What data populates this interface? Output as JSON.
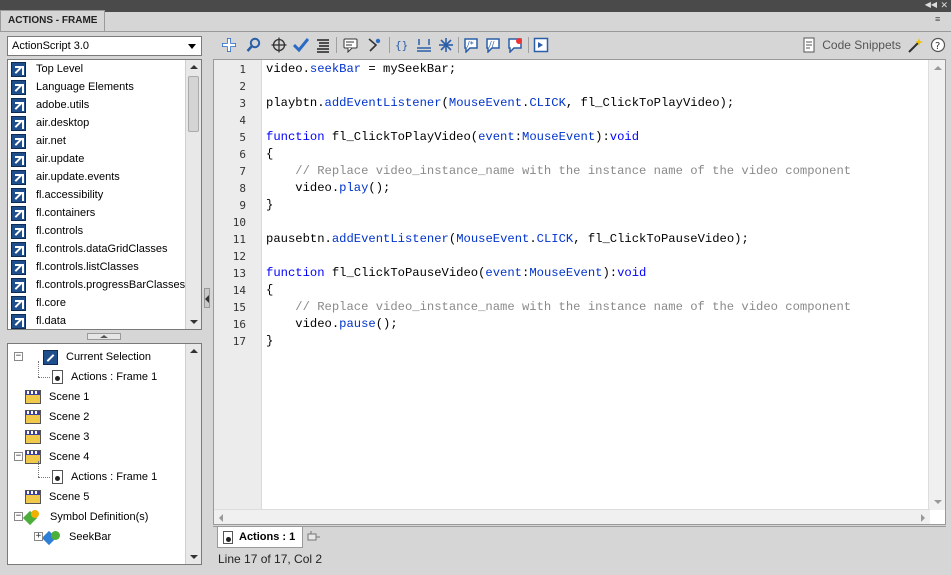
{
  "window": {
    "title": "ACTIONS - FRAME"
  },
  "left_panel": {
    "version_select": "ActionScript 3.0",
    "packages": [
      {
        "label": "Top Level"
      },
      {
        "label": "Language Elements"
      },
      {
        "label": "adobe.utils"
      },
      {
        "label": "air.desktop"
      },
      {
        "label": "air.net"
      },
      {
        "label": "air.update"
      },
      {
        "label": "air.update.events"
      },
      {
        "label": "fl.accessibility"
      },
      {
        "label": "fl.containers"
      },
      {
        "label": "fl.controls"
      },
      {
        "label": "fl.controls.dataGridClasses"
      },
      {
        "label": "fl.controls.listClasses"
      },
      {
        "label": "fl.controls.progressBarClasses"
      },
      {
        "label": "fl.core"
      },
      {
        "label": "fl.data"
      }
    ],
    "tree": [
      {
        "label": "Current Selection",
        "icon": "selection-icon"
      },
      {
        "label": "Actions : Frame 1",
        "icon": "frame-icon"
      },
      {
        "label": "Scene 1",
        "icon": "scene-icon"
      },
      {
        "label": "Scene 2",
        "icon": "scene-icon"
      },
      {
        "label": "Scene 3",
        "icon": "scene-icon"
      },
      {
        "label": "Scene 4",
        "icon": "scene-icon"
      },
      {
        "label": "Actions : Frame 1",
        "icon": "frame-icon"
      },
      {
        "label": "Scene 5",
        "icon": "scene-icon"
      },
      {
        "label": "Symbol Definition(s)",
        "icon": "symbol-icon"
      },
      {
        "label": "SeekBar",
        "icon": "seekbar-icon"
      }
    ]
  },
  "toolbar": {
    "code_snippets_label": "Code Snippets",
    "icons": [
      "add-statement-icon",
      "find-icon",
      "insert-target-path-icon",
      "check-syntax-icon",
      "auto-format-icon",
      "show-code-hint-icon",
      "debug-options-icon",
      "collapse-between-braces-icon",
      "collapse-selection-icon",
      "expand-all-icon",
      "apply-block-comment-icon",
      "apply-line-comment-icon",
      "remove-comment-icon",
      "show-hide-toolbox-icon",
      "code-snippets-icon",
      "wizard-icon",
      "help-icon"
    ]
  },
  "editor": {
    "lines": [
      {
        "n": "1",
        "segments": [
          {
            "t": "video."
          },
          {
            "t": "seekBar",
            "c": "fn"
          },
          {
            "t": " = mySeekBar;"
          }
        ]
      },
      {
        "n": "2",
        "segments": []
      },
      {
        "n": "3",
        "segments": [
          {
            "t": "playbtn."
          },
          {
            "t": "addEventListener",
            "c": "fn"
          },
          {
            "t": "("
          },
          {
            "t": "MouseEvent",
            "c": "ty"
          },
          {
            "t": "."
          },
          {
            "t": "CLICK",
            "c": "fn"
          },
          {
            "t": ", fl_ClickToPlayVideo);"
          }
        ]
      },
      {
        "n": "4",
        "segments": []
      },
      {
        "n": "5",
        "segments": [
          {
            "t": "function",
            "c": "kw"
          },
          {
            "t": " fl_ClickToPlayVideo("
          },
          {
            "t": "event",
            "c": "fn"
          },
          {
            "t": ":"
          },
          {
            "t": "MouseEvent",
            "c": "ty"
          },
          {
            "t": "):"
          },
          {
            "t": "void",
            "c": "kw"
          }
        ]
      },
      {
        "n": "6",
        "segments": [
          {
            "t": "{"
          }
        ]
      },
      {
        "n": "7",
        "segments": [
          {
            "t": "    "
          },
          {
            "t": "// Replace video_instance_name with the instance name of the video component",
            "c": "cm"
          }
        ]
      },
      {
        "n": "8",
        "segments": [
          {
            "t": "    video."
          },
          {
            "t": "play",
            "c": "fn"
          },
          {
            "t": "();"
          }
        ]
      },
      {
        "n": "9",
        "segments": [
          {
            "t": "}"
          }
        ]
      },
      {
        "n": "10",
        "segments": []
      },
      {
        "n": "11",
        "segments": [
          {
            "t": "pausebtn."
          },
          {
            "t": "addEventListener",
            "c": "fn"
          },
          {
            "t": "("
          },
          {
            "t": "MouseEvent",
            "c": "ty"
          },
          {
            "t": "."
          },
          {
            "t": "CLICK",
            "c": "fn"
          },
          {
            "t": ", fl_ClickToPauseVideo);"
          }
        ]
      },
      {
        "n": "12",
        "segments": []
      },
      {
        "n": "13",
        "segments": [
          {
            "t": "function",
            "c": "kw"
          },
          {
            "t": " fl_ClickToPauseVideo("
          },
          {
            "t": "event",
            "c": "fn"
          },
          {
            "t": ":"
          },
          {
            "t": "MouseEvent",
            "c": "ty"
          },
          {
            "t": "):"
          },
          {
            "t": "void",
            "c": "kw"
          }
        ]
      },
      {
        "n": "14",
        "segments": [
          {
            "t": "{"
          }
        ]
      },
      {
        "n": "15",
        "segments": [
          {
            "t": "    "
          },
          {
            "t": "// Replace video_instance_name with the instance name of the video component",
            "c": "cm"
          }
        ]
      },
      {
        "n": "16",
        "segments": [
          {
            "t": "    video."
          },
          {
            "t": "pause",
            "c": "fn"
          },
          {
            "t": "();"
          }
        ]
      },
      {
        "n": "17",
        "segments": [
          {
            "t": "}"
          }
        ]
      }
    ]
  },
  "tabs": [
    {
      "label": "Actions : 1"
    }
  ],
  "status_bar": {
    "text": "Line 17 of 17, Col 2"
  }
}
